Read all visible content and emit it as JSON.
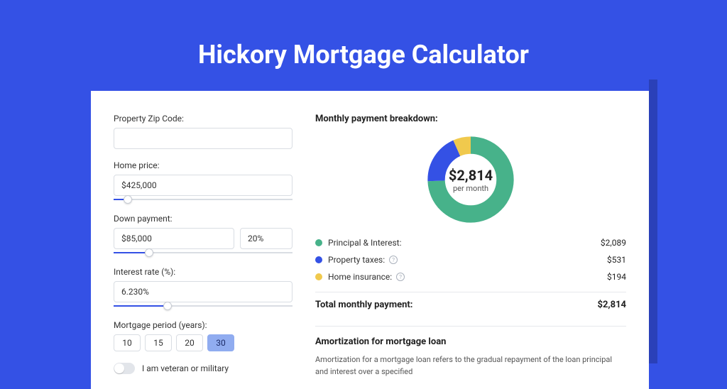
{
  "page": {
    "title": "Hickory Mortgage Calculator"
  },
  "form": {
    "zip": {
      "label": "Property Zip Code:",
      "value": ""
    },
    "home_price": {
      "label": "Home price:",
      "value": "$425,000",
      "slider_percent": 8
    },
    "down": {
      "label": "Down payment:",
      "amount": "$85,000",
      "percent": "20%",
      "slider_percent": 20
    },
    "rate": {
      "label": "Interest rate (%):",
      "value": "6.230%",
      "slider_percent": 30
    },
    "period": {
      "label": "Mortgage period (years):",
      "options": [
        "10",
        "15",
        "20",
        "30"
      ],
      "selected": "30"
    },
    "veteran": {
      "label": "I am veteran or military",
      "on": false
    }
  },
  "breakdown": {
    "title": "Monthly payment breakdown:",
    "center_amount": "$2,814",
    "center_sub": "per month",
    "items": [
      {
        "key": "pi",
        "label": "Principal & Interest:",
        "value": "$2,089",
        "color": "#47b28a",
        "has_help": false
      },
      {
        "key": "tax",
        "label": "Property taxes:",
        "value": "$531",
        "color": "#3451e5",
        "has_help": true
      },
      {
        "key": "ins",
        "label": "Home insurance:",
        "value": "$194",
        "color": "#f0c94d",
        "has_help": true
      }
    ],
    "total": {
      "label": "Total monthly payment:",
      "value": "$2,814"
    }
  },
  "chart_data": {
    "type": "pie",
    "title": "Monthly payment breakdown",
    "categories": [
      "Principal & Interest",
      "Property taxes",
      "Home insurance"
    ],
    "values": [
      2089,
      531,
      194
    ],
    "colors": [
      "#47b28a",
      "#3451e5",
      "#f0c94d"
    ],
    "total": 2814,
    "center_label": "$2,814 per month"
  },
  "amortization": {
    "title": "Amortization for mortgage loan",
    "text": "Amortization for a mortgage loan refers to the gradual repayment of the loan principal and interest over a specified"
  }
}
